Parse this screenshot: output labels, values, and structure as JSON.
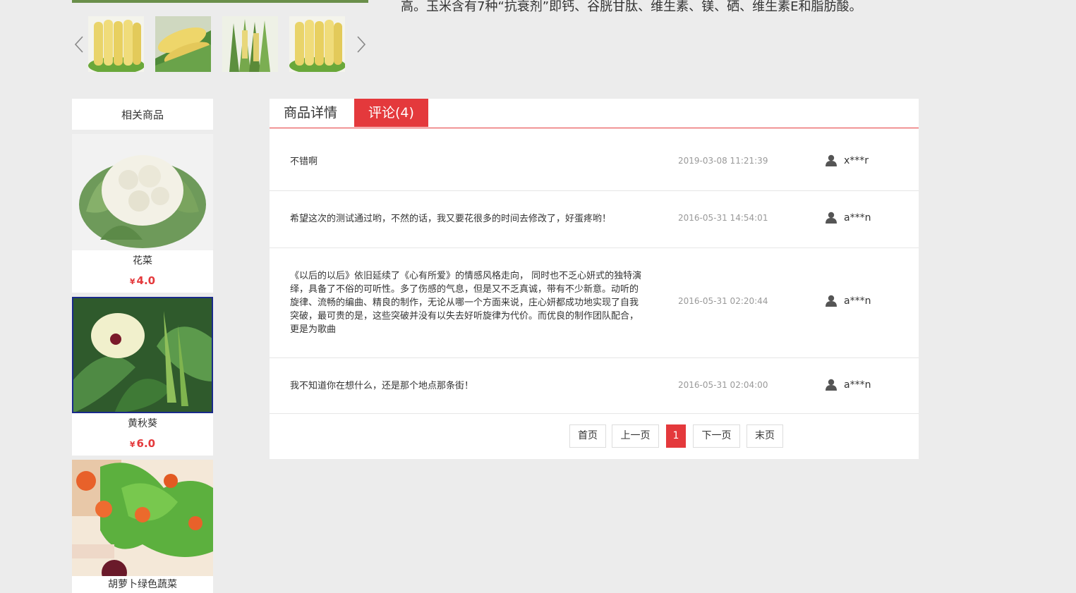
{
  "product": {
    "description": "高。玉米含有7种“抗衰剂”即钙、谷胱甘肽、维生素、镁、硒、维生素E和脂肪酸。"
  },
  "gallery": {
    "prev_icon": "chevron-left-icon",
    "next_icon": "chevron-right-icon",
    "thumbnails": [
      "corn-thumbnail-1",
      "corn-thumbnail-2",
      "corn-thumbnail-3",
      "corn-thumbnail-4"
    ]
  },
  "sidebar": {
    "title": "相关商品",
    "items": [
      {
        "name": "花菜",
        "currency": "¥",
        "price": "4.0"
      },
      {
        "name": "黄秋葵",
        "currency": "¥",
        "price": "6.0"
      },
      {
        "name": "胡萝卜绿色蔬菜",
        "currency": "¥",
        "price": ""
      }
    ]
  },
  "tabs": {
    "detail": "商品详情",
    "comments": "评论(4)"
  },
  "comments": [
    {
      "text": "不错啊",
      "date": "2019-03-08 11:21:39",
      "user": "x***r"
    },
    {
      "text": "希望这次的测试通过哟，不然的话，我又要花很多的时间去修改了，好蛋疼哟！",
      "date": "2016-05-31 14:54:01",
      "user": "a***n"
    },
    {
      "text": "《以后的以后》依旧延续了《心有所爱》的情感风格走向， 同时也不乏心妍式的独特演绎，具备了不俗的可听性。多了伤感的气息，但是又不乏真诚，带有不少新意。动听的旋律、流畅的编曲、精良的制作，无论从哪一个方面来说，庄心妍都成功地实现了自我突破，最可贵的是，这些突破并没有以失去好听旋律为代价。而优良的制作团队配合，更是为歌曲",
      "date": "2016-05-31 02:20:44",
      "user": "a***n"
    },
    {
      "text": "我不知道你在想什么，还是那个地点那条街！",
      "date": "2016-05-31 02:04:00",
      "user": "a***n"
    }
  ],
  "pagination": {
    "first": "首页",
    "prev": "上一页",
    "current": "1",
    "next": "下一页",
    "last": "末页"
  },
  "colors": {
    "accent": "#e4393c",
    "background": "#ececec"
  }
}
